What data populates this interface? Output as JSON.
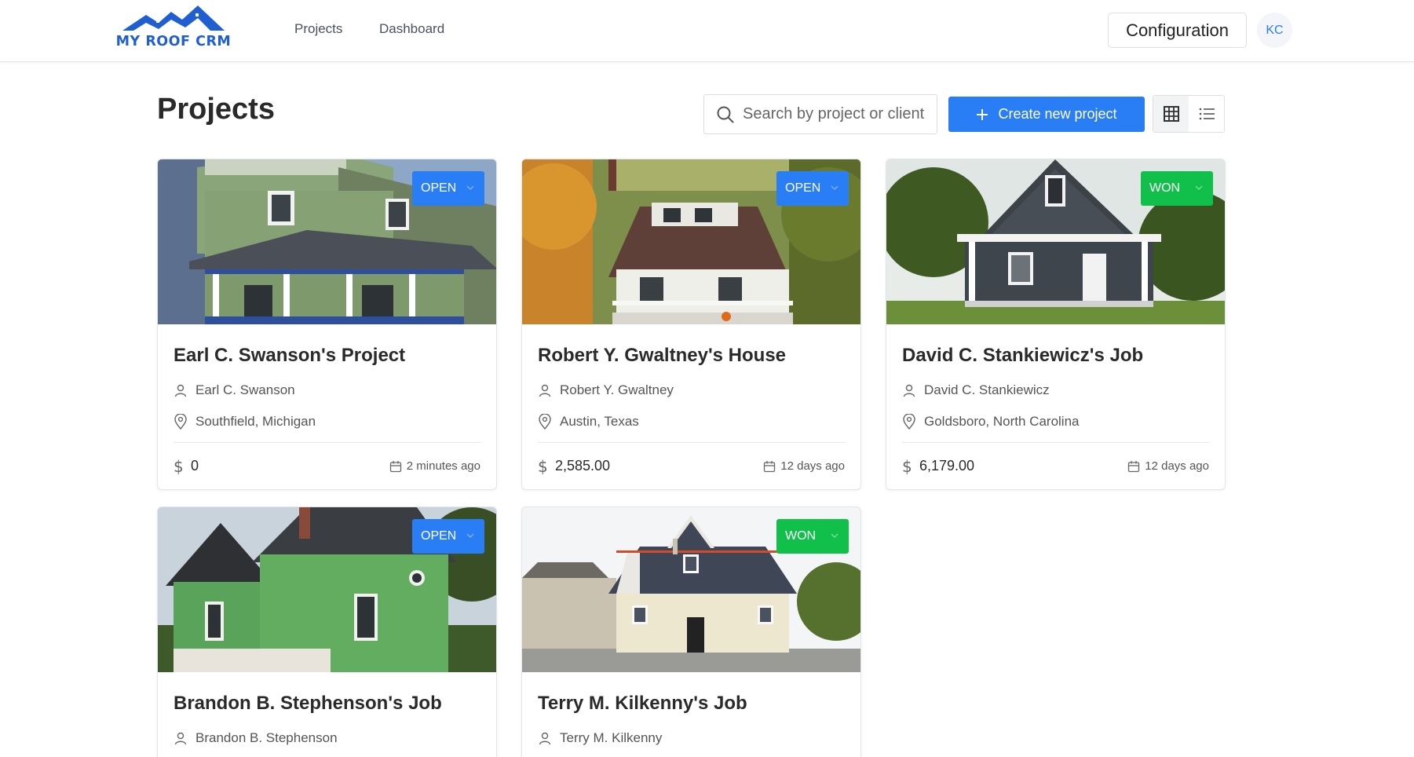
{
  "brand": {
    "name": "MY ROOF CRM",
    "color": "#1f5fd1"
  },
  "nav": {
    "projects": "Projects",
    "dashboard": "Dashboard"
  },
  "header": {
    "config_label": "Configuration",
    "avatar_initials": "KC"
  },
  "page": {
    "title": "Projects"
  },
  "search": {
    "placeholder": "Search by project or client"
  },
  "toolbar": {
    "create_label": "Create new project",
    "view_mode": "grid"
  },
  "colors": {
    "accent": "#2a7ef5",
    "open": "#2a7ef5",
    "won": "#10c04a"
  },
  "projects": [
    {
      "title": "Earl C. Swanson's Project",
      "client": "Earl C. Swanson",
      "location": "Southfield, Michigan",
      "amount": "0",
      "updated": "2 minutes ago",
      "status": "OPEN"
    },
    {
      "title": "Robert Y. Gwaltney's House",
      "client": "Robert Y. Gwaltney",
      "location": "Austin, Texas",
      "amount": "2,585.00",
      "updated": "12 days ago",
      "status": "OPEN"
    },
    {
      "title": "David C. Stankiewicz's Job",
      "client": "David C. Stankiewicz",
      "location": "Goldsboro, North Carolina",
      "amount": "6,179.00",
      "updated": "12 days ago",
      "status": "WON"
    },
    {
      "title": "Brandon B. Stephenson's Job",
      "client": "Brandon B. Stephenson",
      "status": "OPEN"
    },
    {
      "title": "Terry M. Kilkenny's Job",
      "client": "Terry M. Kilkenny",
      "status": "WON"
    }
  ]
}
